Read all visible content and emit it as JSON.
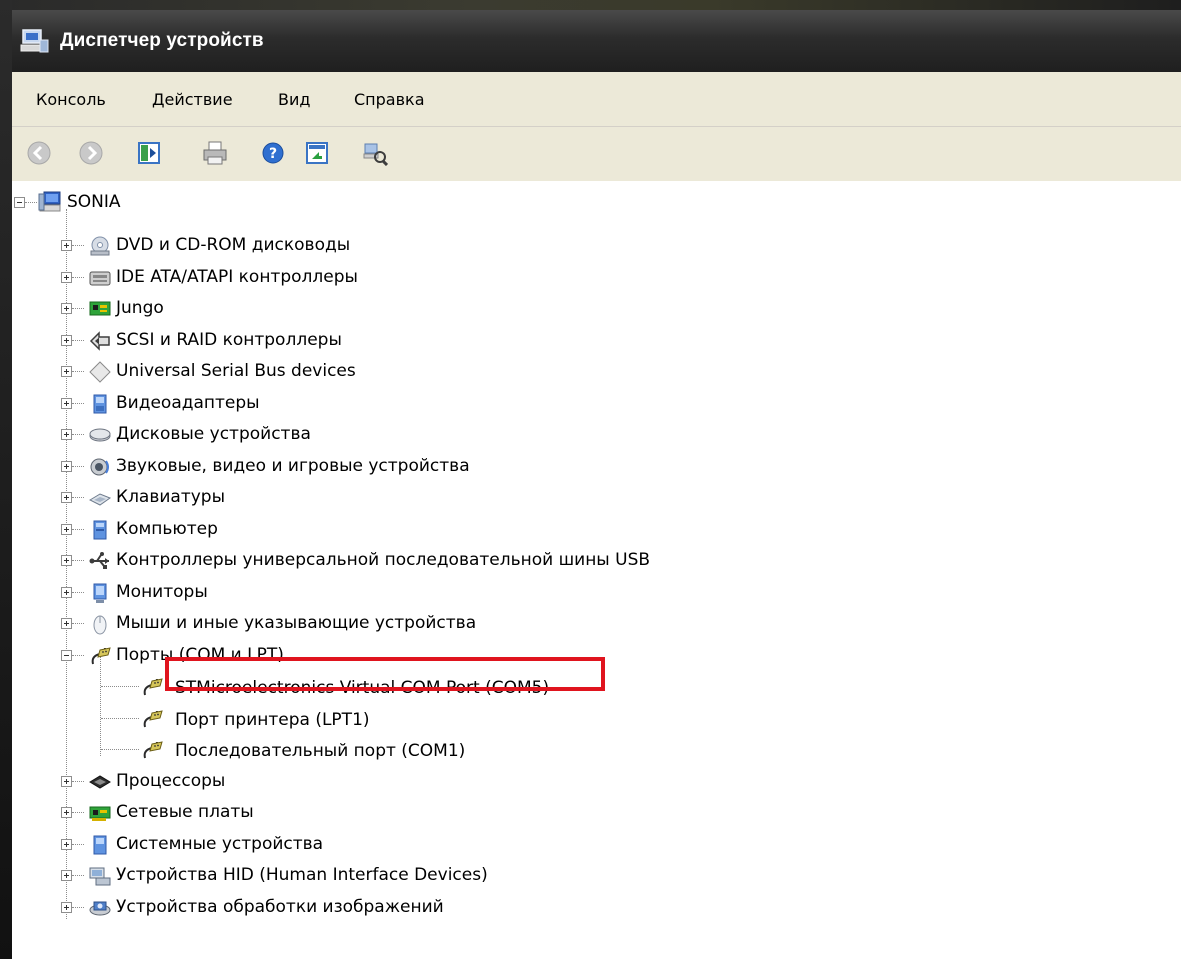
{
  "window": {
    "title": "Диспетчер устройств"
  },
  "menu": [
    "Консоль",
    "Действие",
    "Вид",
    "Справка"
  ],
  "toolbar": [
    {
      "icon": "back-icon"
    },
    {
      "icon": "forward-icon"
    },
    {
      "icon": "console-tree-icon"
    },
    {
      "icon": "print-icon"
    },
    {
      "icon": "help-icon"
    },
    {
      "icon": "properties-icon"
    },
    {
      "icon": "scan-hardware-icon"
    }
  ],
  "tree": {
    "root": "SONIA",
    "categories": [
      {
        "label": "DVD и CD-ROM дисководы",
        "icon": "dvd-drive-icon",
        "expanded": false
      },
      {
        "label": "IDE ATA/ATAPI контроллеры",
        "icon": "ide-controller-icon",
        "expanded": false
      },
      {
        "label": "Jungo",
        "icon": "board-icon",
        "expanded": false
      },
      {
        "label": "SCSI и RAID контроллеры",
        "icon": "scsi-icon",
        "expanded": false
      },
      {
        "label": "Universal Serial Bus devices",
        "icon": "usb-diamond-icon",
        "expanded": false
      },
      {
        "label": "Видеоадаптеры",
        "icon": "display-adapter-icon",
        "expanded": false
      },
      {
        "label": "Дисковые устройства",
        "icon": "disk-drive-icon",
        "expanded": false
      },
      {
        "label": "Звуковые, видео и игровые устройства",
        "icon": "sound-icon",
        "expanded": false
      },
      {
        "label": "Клавиатуры",
        "icon": "keyboard-icon",
        "expanded": false
      },
      {
        "label": "Компьютер",
        "icon": "computer-icon",
        "expanded": false
      },
      {
        "label": "Контроллеры универсальной последовательной шины USB",
        "icon": "usb-icon",
        "expanded": false
      },
      {
        "label": "Мониторы",
        "icon": "monitor-icon",
        "expanded": false
      },
      {
        "label": "Мыши и иные указывающие устройства",
        "icon": "mouse-icon",
        "expanded": false
      },
      {
        "label": "Порты (COM и LPT)",
        "icon": "port-icon",
        "expanded": true,
        "children": [
          {
            "label": "STMicroelectronics Virtual COM Port (COM5)",
            "icon": "port-icon",
            "highlighted": true
          },
          {
            "label": "Порт принтера (LPT1)",
            "icon": "port-icon"
          },
          {
            "label": "Последовательный порт (COM1)",
            "icon": "port-icon"
          }
        ]
      },
      {
        "label": "Процессоры",
        "icon": "processor-icon",
        "expanded": false
      },
      {
        "label": "Сетевые платы",
        "icon": "network-card-icon",
        "expanded": false
      },
      {
        "label": "Системные устройства",
        "icon": "system-device-icon",
        "expanded": false
      },
      {
        "label": "Устройства HID (Human Interface Devices)",
        "icon": "hid-icon",
        "expanded": false
      },
      {
        "label": "Устройства обработки изображений",
        "icon": "imaging-icon",
        "expanded": false
      }
    ]
  },
  "colors": {
    "titlebar": "#2c2c2c",
    "menubar": "#ece9d8",
    "highlight_box": "#e0141e"
  }
}
